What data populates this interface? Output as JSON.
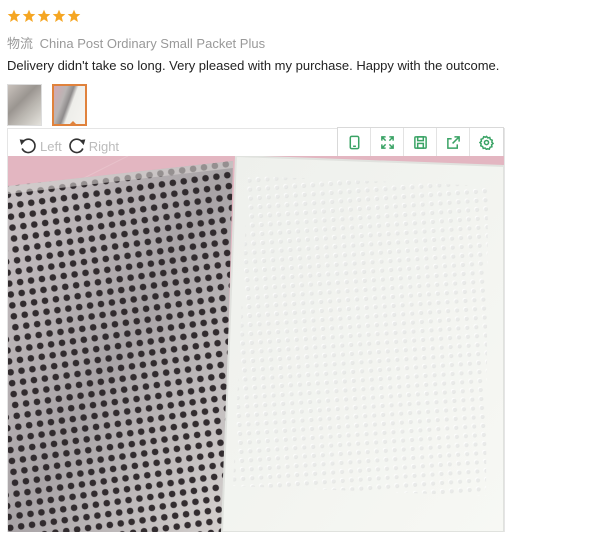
{
  "rating": {
    "stars": 5,
    "star_color": "#f5a623"
  },
  "logistics": {
    "label": "物流",
    "method": "China Post Ordinary Small Packet Plus"
  },
  "review": {
    "text": "Delivery didn't take so long. Very pleased with my purchase. Happy with the outcome."
  },
  "thumbnails": [
    {
      "name": "photo-thumbnail-1",
      "active": false
    },
    {
      "name": "photo-thumbnail-2",
      "active": true
    }
  ],
  "viewer": {
    "rotate_left_label": "Left",
    "rotate_right_label": "Right",
    "toolbar_icons": [
      "phone-icon",
      "fullscreen-icon",
      "save-icon",
      "share-icon",
      "settings-icon"
    ],
    "accent_color": "#3aa365",
    "active_border_color": "#e0823c"
  }
}
